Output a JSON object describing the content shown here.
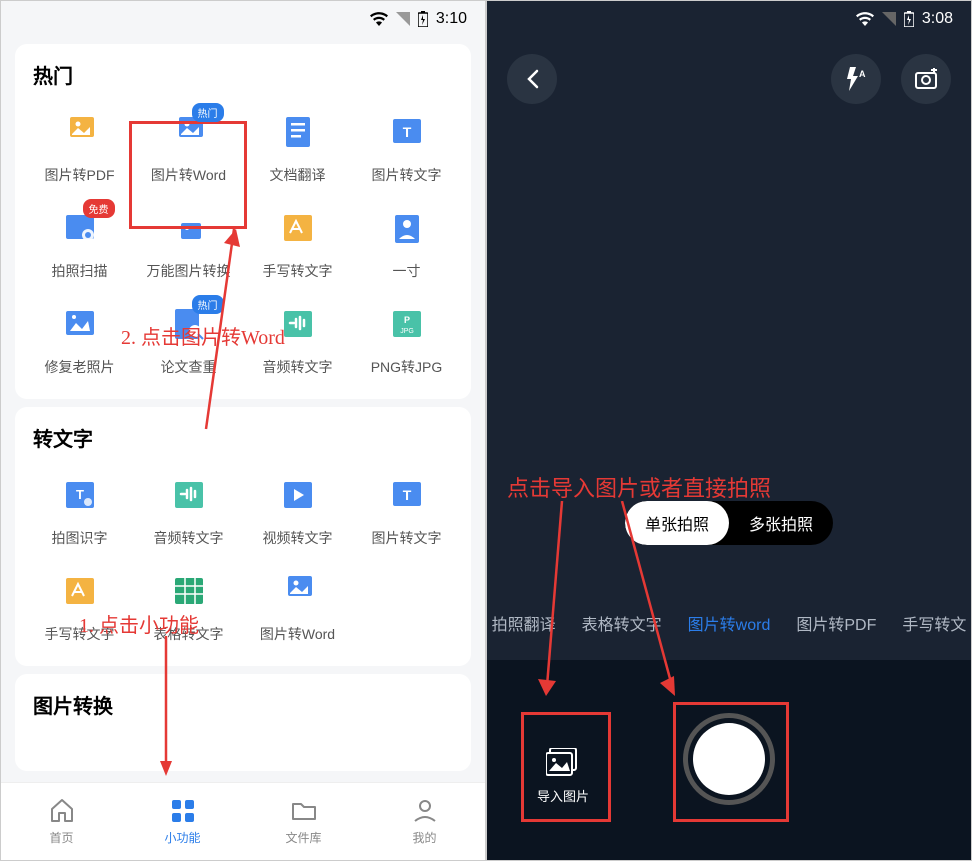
{
  "left": {
    "status": {
      "time": "3:10"
    },
    "sections": {
      "hot": {
        "title": "热门",
        "items": [
          {
            "label": "图片转PDF",
            "color": "#f4b342",
            "badge": null,
            "icon": "image-doc"
          },
          {
            "label": "图片转Word",
            "color": "#4a8cf0",
            "badge": "热门",
            "badgeType": "hot",
            "icon": "image-doc"
          },
          {
            "label": "文档翻译",
            "color": "#4a8cf0",
            "badge": null,
            "icon": "doc-lines"
          },
          {
            "label": "图片转文字",
            "color": "#4a8cf0",
            "badge": null,
            "icon": "image-text"
          },
          {
            "label": "拍照扫描",
            "color": "#4a8cf0",
            "badge": "免费",
            "badgeType": "free",
            "icon": "scan"
          },
          {
            "label": "万能图片转换",
            "color": "#4a8cf0",
            "badge": null,
            "icon": "convert"
          },
          {
            "label": "手写转文字",
            "color": "#f4b342",
            "badge": null,
            "icon": "handwrite"
          },
          {
            "label": "一寸",
            "color": "#4a8cf0",
            "badge": null,
            "icon": "id-photo"
          },
          {
            "label": "修复老照片",
            "color": "#4a8cf0",
            "badge": null,
            "icon": "restore"
          },
          {
            "label": "论文查重",
            "color": "#4a8cf0",
            "badge": "热门",
            "badgeType": "hot",
            "icon": "plagiarism"
          },
          {
            "label": "音频转文字",
            "color": "#49c2a8",
            "badge": null,
            "icon": "audio"
          },
          {
            "label": "PNG转JPG",
            "color": "#49c2a8",
            "badge": null,
            "icon": "png-jpg"
          }
        ]
      },
      "toText": {
        "title": "转文字",
        "items": [
          {
            "label": "拍图识字",
            "color": "#4a8cf0",
            "icon": "ocr"
          },
          {
            "label": "音频转文字",
            "color": "#49c2a8",
            "icon": "audio"
          },
          {
            "label": "视频转文字",
            "color": "#4a8cf0",
            "icon": "video"
          },
          {
            "label": "图片转文字",
            "color": "#4a8cf0",
            "icon": "image-text"
          },
          {
            "label": "手写转文字",
            "color": "#f4b342",
            "icon": "handwrite"
          },
          {
            "label": "表格转文字",
            "color": "#2aa876",
            "icon": "table"
          },
          {
            "label": "图片转Word",
            "color": "#4a8cf0",
            "icon": "image-doc"
          },
          {
            "label": "",
            "color": "transparent",
            "icon": ""
          }
        ]
      },
      "imgConvert": {
        "title": "图片转换"
      }
    },
    "nav": {
      "items": [
        {
          "label": "首页",
          "icon": "home",
          "active": false
        },
        {
          "label": "小功能",
          "icon": "grid",
          "active": true
        },
        {
          "label": "文件库",
          "icon": "folder",
          "active": false
        },
        {
          "label": "我的",
          "icon": "person",
          "active": false
        }
      ]
    },
    "anno1": "1. 点击小功能",
    "anno2": "2. 点击图片转Word"
  },
  "right": {
    "status": {
      "time": "3:08"
    },
    "toggle": {
      "single": "单张拍照",
      "multi": "多张拍照"
    },
    "modes": [
      "拍照翻译",
      "表格转文字",
      "图片转word",
      "图片转PDF",
      "手写转文"
    ],
    "activeMode": 2,
    "import": "导入图片",
    "anno": "点击导入图片或者直接拍照"
  }
}
